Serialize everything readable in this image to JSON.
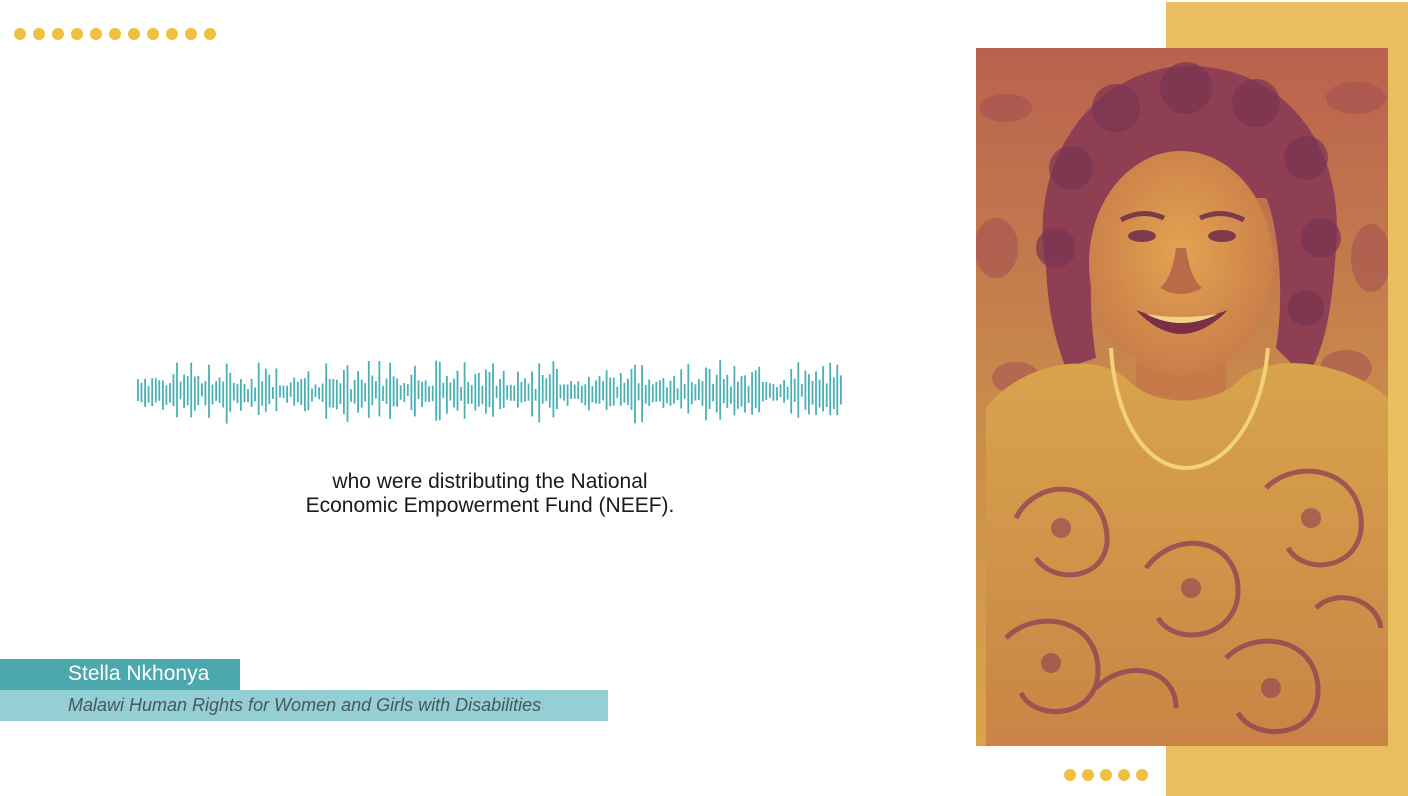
{
  "caption": {
    "line1": "who were distributing the National",
    "line2": "Economic Empowerment Fund (NEEF)."
  },
  "lower_third": {
    "name": "Stella Nkhonya",
    "organization": "Malawi Human Rights for Women and Girls with Disabilities"
  },
  "colors": {
    "accent_gold": "#e9be5e",
    "dot_gold": "#efbf3f",
    "teal": "#4ba8ad",
    "teal_light": "#93cfd3",
    "waveform": "#4bb0b6"
  },
  "icons": {
    "waveform": "audio-waveform-icon",
    "portrait": "speaker-portrait"
  }
}
